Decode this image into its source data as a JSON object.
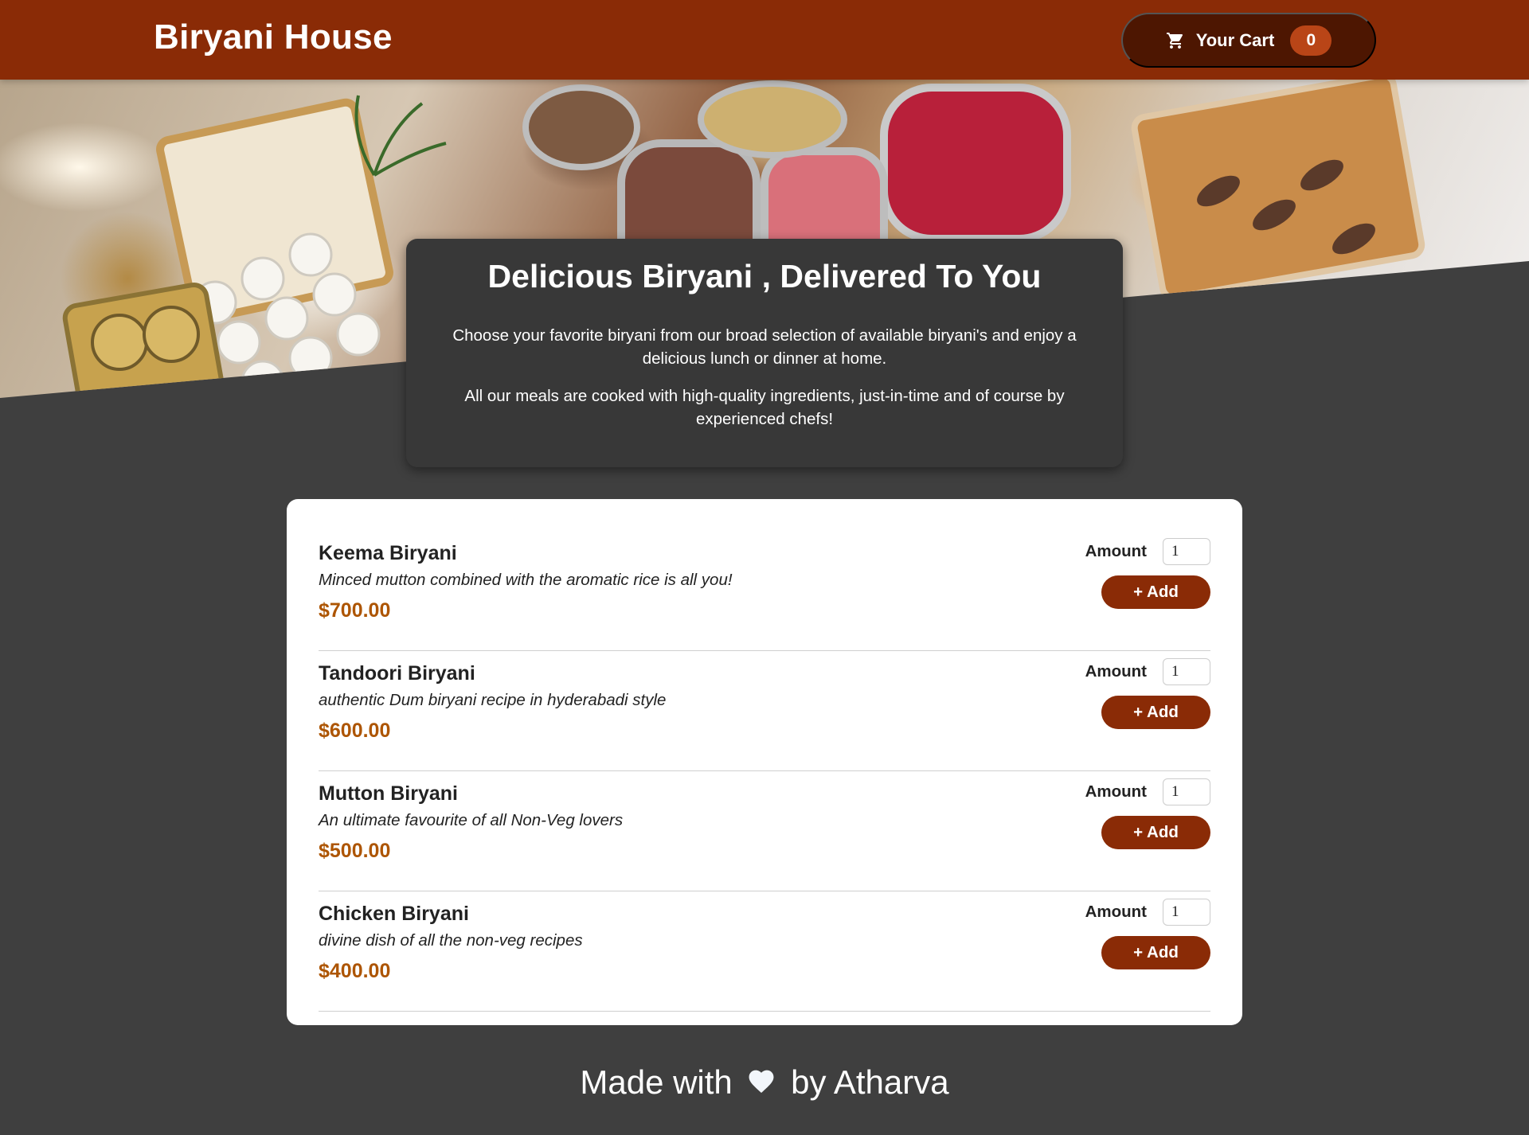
{
  "header": {
    "brand": "Biryani House",
    "cart_label": "Your Cart",
    "cart_count": "0",
    "cart_icon": "cart-icon"
  },
  "hero": {
    "image": "buffet-table-image"
  },
  "summary": {
    "title": "Delicious Biryani , Delivered To You",
    "paragraph_1": "Choose your favorite biryani from our broad selection of available biryani's and enjoy a delicious lunch or dinner at home.",
    "paragraph_2": "All our meals are cooked with high-quality ingredients, just-in-time and of course by experienced chefs!"
  },
  "meals": {
    "amount_label": "Amount",
    "add_label": "+ Add",
    "items": [
      {
        "name": "Keema Biryani",
        "description": "Minced mutton combined with the aromatic rice is all you!",
        "price": "$700.00",
        "amount": "1"
      },
      {
        "name": "Tandoori Biryani",
        "description": "authentic Dum biryani recipe in hyderabadi style",
        "price": "$600.00",
        "amount": "1"
      },
      {
        "name": "Mutton Biryani",
        "description": "An ultimate favourite of all Non-Veg lovers",
        "price": "$500.00",
        "amount": "1"
      },
      {
        "name": "Chicken Biryani",
        "description": "divine dish of all the non-veg recipes",
        "price": "$400.00",
        "amount": "1"
      }
    ]
  },
  "footer": {
    "text_before": "Made with",
    "text_after": "by Atharva",
    "icon": "heart-icon"
  },
  "colors": {
    "header": "#8a2b06",
    "cart_button": "#4d1601",
    "cart_badge": "#b94517",
    "background": "#3f3f3f",
    "summary_card": "#383838",
    "price": "#ad5502",
    "add_button": "#8a2b06"
  }
}
